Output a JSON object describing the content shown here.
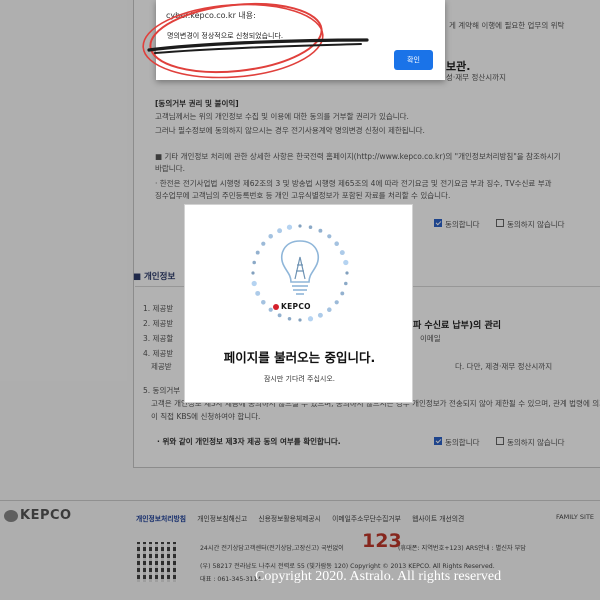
{
  "alert": {
    "title": "cyber.kepco.co.kr 내용:",
    "message": "명의변경이 정상적으로 신청되었습니다.",
    "ok_label": "확인"
  },
  "background": {
    "right_text_1": "게 계약해 이행에 필요한 업무의 위탁",
    "heading_fragment": "보관.",
    "right_text_2": "성·재무 정산시까지",
    "rights_title": "[동의거부 권리 및 불이익]",
    "rights_line_1": "고객님께서는 위의 개인정보 수집 및 이용에 대한 동의를 거부할 권리가 있습니다.",
    "rights_line_2": "그러나 필수정보에 동의하지 않으시는 경우 전기사용계약 명의변경 신청이 제한됩니다.",
    "note_line_1": "■ 기타 개인정보 처리에 관한 상세한 사항은 한국전력 홈페이지(http://www.kepco.co.kr)의 \"개인정보처리방침\"을 참조하시기",
    "note_line_2": "바랍니다.",
    "note_line_3": "· 한전은 전기사업법 시행령 제62조의 3 및 방송법 시행령 제65조의 4에 따라 전기요금 및 전기요금 부과 징수, TV수신료 부과",
    "note_line_4": "징수업무에 고객님의 주민등록번호 등 개인 고유식별정보가 포함된 자료를 처리할 수 있습니다.",
    "agree_label": "동의합니다",
    "disagree_label": "동의하지 않습니다",
    "section_title": "■ 개인정보",
    "list_1": "1. 제공받",
    "list_2": "2. 제공받",
    "list_3": "3. 제공할",
    "list_4": "4. 제공받",
    "list_4b": "제공받",
    "right_heading_2": "파 수신료 납부)의 관리",
    "right_text_3": "이메일",
    "right_text_4": "다. 다만, 제경·재무 정산시까지",
    "list_5": "5. 동의거부",
    "list_5b": "고객은 개인정보 제3자 제공에 동의하지 않으실 수 있으며, 동의하지 않으시는 경우 개인정보가 전송되지 않아 제한될 수 있으며, 관계 법령에 의거 필요",
    "list_5c": "이 직접 KBS에 신청하여야 합니다.",
    "confirm_line": "· 위와 같이 개인정보 제3자 제공 동의 여부를 확인합니다."
  },
  "footer": {
    "logo_text": "KEPCO",
    "links": [
      "개인정보처리방침",
      "개인정보침해신고",
      "신용정보활용체제공시",
      "이메일주소무단수집거부",
      "웹사이트 개선의견"
    ],
    "family_site": "FAMILY SITE",
    "line_1": "24시간 전기상담고객센터(전기상담,고장신고) 국번없이",
    "number_big": "123",
    "line_1b": "(휴대폰: 지역번호+123) ARS안내 : 별신자 부담",
    "line_2": "(우) 58217 전라남도 나주시 전력로 55 (빛가람동 120) Copyright © 2013 KEPCO. All Rights Reserved.",
    "line_3": "대표 : 061-345-3114"
  },
  "loader": {
    "title": "페이지를 불러오는 중입니다.",
    "subtitle": "잠시만 기다려 주십시오.",
    "logo_text": "KEPCO"
  },
  "watermark": {
    "text": "Copyright 2020. Astralo. All rights reserved"
  },
  "colors": {
    "accent": "#1a73e8",
    "scribble": "#e0403c",
    "kepco_red": "#d41f2b"
  }
}
